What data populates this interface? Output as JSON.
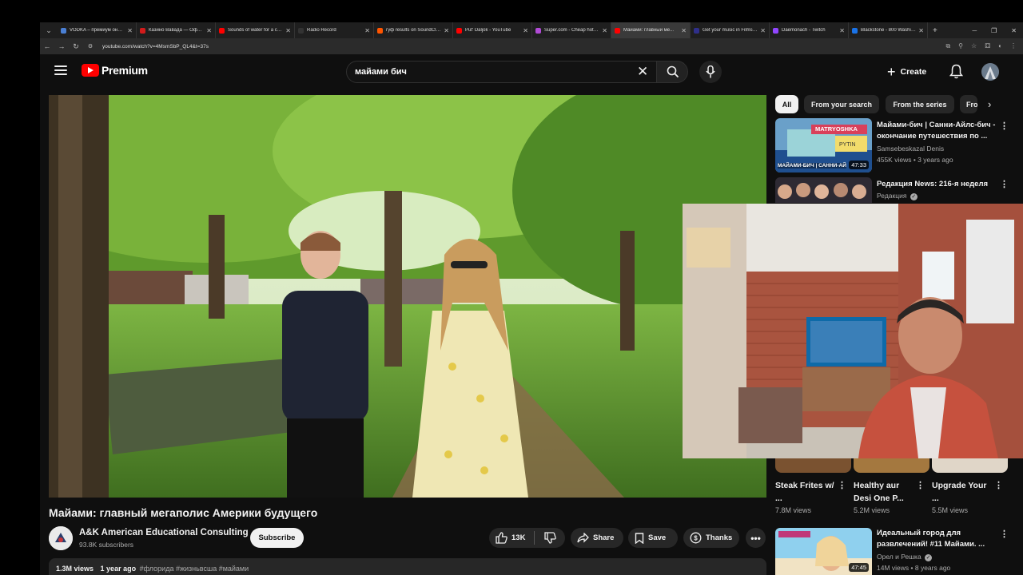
{
  "browser": {
    "tabs": [
      {
        "title": "VODKA – премиум онлайн...",
        "color": "#4a7fd4"
      },
      {
        "title": "Казино Вавада — Официа...",
        "color": "#d21b1b"
      },
      {
        "title": "Sounds of water for a chi...",
        "color": "#ff0000"
      },
      {
        "title": "Radio Record",
        "color": "#333333"
      },
      {
        "title": "гуф results on SoundClou...",
        "color": "#ff5500"
      },
      {
        "title": "Put' Daljok - YouTube",
        "color": "#ff0000"
      },
      {
        "title": "Super.com - Cheap hotel...",
        "color": "#b14bd6"
      },
      {
        "title": "Майами: главный ме...",
        "color": "#ff0000"
      },
      {
        "title": "Get your music in Films &...",
        "color": "#2f2f8a"
      },
      {
        "title": "Daemonach - Twitch",
        "color": "#9146ff"
      },
      {
        "title": "Blackstone - 800 Washing...",
        "color": "#1a73e8"
      }
    ],
    "new_tab": "+",
    "url": "youtube.com/watch?v=4MsmSbP_QL4&t=37s"
  },
  "header": {
    "logo_text": "Premium",
    "search_value": "майами бич",
    "create_label": "Create"
  },
  "video": {
    "title": "Майами: главный мегаполис Америки будущего",
    "channel": "A&K American Educational Consulting",
    "subscribers": "93.8K subscribers",
    "subscribe_label": "Subscribe",
    "likes": "13K",
    "share_label": "Share",
    "save_label": "Save",
    "thanks_label": "Thanks",
    "views": "1.3M views",
    "age": "1 year ago",
    "tags": "#флорида #жизньвсша #майами"
  },
  "chips": [
    "All",
    "From your search",
    "From the series",
    "Fro"
  ],
  "sidebar": [
    {
      "title": "Майами-бич | Санни-Айлс-бич - окончание путешествия по ...",
      "channel": "Samsebeskazal Denis",
      "meta": "455K views • 3 years ago",
      "duration": "47:33",
      "thumb_label": "МАЙАМИ-БИЧ | САННИ-АЙ",
      "thumb_badge": "MATRYOSHKA"
    },
    {
      "title": "Редакция News: 216-я неделя",
      "channel": "Редакция",
      "meta": "",
      "duration": ""
    },
    {
      "title": "Идеальный город для развлечений! #11 Майами. ...",
      "channel": "Орел и Решка",
      "meta": "14M views • 8 years ago",
      "duration": "47:45"
    }
  ],
  "shorts": [
    {
      "title": "Steak Frites w/ ...",
      "views": "7.8M views"
    },
    {
      "title": "Healthy aur Desi One P...",
      "views": "5.2M views"
    },
    {
      "title": "Upgrade Your ...",
      "views": "5.5M views"
    }
  ]
}
